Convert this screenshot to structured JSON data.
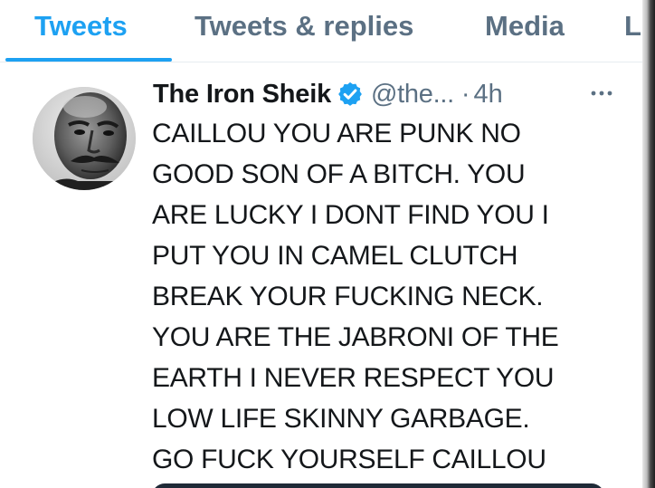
{
  "tabs": [
    {
      "label": "Tweets",
      "active": true
    },
    {
      "label": "Tweets & replies",
      "active": false
    },
    {
      "label": "Media",
      "active": false
    },
    {
      "label": "L",
      "active": false
    }
  ],
  "tweet": {
    "display_name": "The Iron Sheik",
    "verified": true,
    "handle": "@the...",
    "separator": "·",
    "timestamp": "4h",
    "lines": [
      "CAILLOU YOU ARE PUNK NO",
      "GOOD SON OF A BITCH. YOU",
      "ARE LUCKY I DONT FIND YOU I",
      "PUT YOU IN CAMEL CLUTCH",
      "BREAK YOUR FUCKING NECK.",
      "YOU ARE THE JABRONI OF THE",
      "EARTH I NEVER RESPECT YOU",
      "LOW LIFE SKINNY GARBAGE.",
      "GO FUCK YOURSELF CAILLOU"
    ]
  },
  "colors": {
    "accent": "#1da1f2",
    "secondary_text": "#5b7083",
    "primary_text": "#14171a"
  },
  "icons": {
    "verified": "verified-badge-icon",
    "more": "more-horizontal-icon"
  }
}
